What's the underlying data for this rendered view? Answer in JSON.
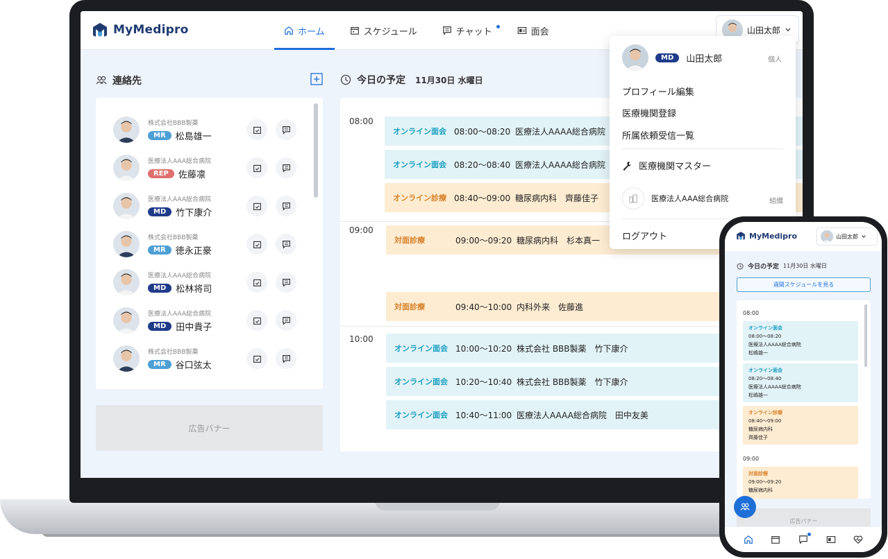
{
  "app": {
    "name": "MyMedipro"
  },
  "nav": [
    {
      "label": "ホーム",
      "icon": "home-icon",
      "active": true
    },
    {
      "label": "スケジュール",
      "icon": "calendar-icon"
    },
    {
      "label": "チャット",
      "icon": "chat-icon"
    },
    {
      "label": "面会",
      "icon": "id-card-icon"
    }
  ],
  "user": {
    "name": "山田太郎"
  },
  "contacts": {
    "title": "連絡先",
    "items": [
      {
        "org": "株式会社BBB製薬",
        "badge": "MR",
        "name": "松島雄一"
      },
      {
        "org": "医療法人AAA総合病院",
        "badge": "REP",
        "name": "佐藤凛"
      },
      {
        "org": "医療法人AAA総合病院",
        "badge": "MD",
        "name": "竹下康介"
      },
      {
        "org": "株式会社BBB製薬",
        "badge": "MR",
        "name": "徳永正豪"
      },
      {
        "org": "医療法人AAA総合病院",
        "badge": "MD",
        "name": "松林将司"
      },
      {
        "org": "医療法人AAA総合病院",
        "badge": "MD",
        "name": "田中貴子"
      },
      {
        "org": "株式会社BBB製薬",
        "badge": "MR",
        "name": "谷口弦太"
      }
    ]
  },
  "ad_banner": "広告バナー",
  "schedule": {
    "title": "今日の予定",
    "date": "11月30日 水曜日",
    "hours": [
      "08:00",
      "09:00",
      "10:00"
    ],
    "events": [
      {
        "type": "オンライン面会",
        "time": "08:00〜08:20",
        "desc": "医療法人AAAA総合病院",
        "kind": "online"
      },
      {
        "type": "オンライン面会",
        "time": "08:20〜08:40",
        "desc": "医療法人AAAA総合病院",
        "kind": "online"
      },
      {
        "type": "オンライン診療",
        "time": "08:40〜09:00",
        "desc": "糖尿病内科　齊藤佳子",
        "kind": "face"
      },
      {
        "type": "対面診療",
        "time": "09:00〜09:20",
        "desc": "糖尿病内科　杉本真一",
        "kind": "face"
      },
      {
        "type": "対面診療",
        "time": "09:40〜10:00",
        "desc": "内科外来　佐藤進",
        "kind": "face"
      },
      {
        "type": "オンライン面会",
        "time": "10:00〜10:20",
        "desc": "株式会社 BBB製薬　竹下康介",
        "kind": "online"
      },
      {
        "type": "オンライン面会",
        "time": "10:20〜10:40",
        "desc": "株式会社 BBB製薬　竹下康介",
        "kind": "online"
      },
      {
        "type": "オンライン面会",
        "time": "10:40〜11:00",
        "desc": "医療法人AAAA総合病院　田中友美",
        "kind": "online"
      }
    ]
  },
  "dropdown": {
    "badge": "MD",
    "name": "山田太郎",
    "personal_tag": "個人",
    "items": [
      "プロフィール編集",
      "医療機関登録",
      "所属依頼受信一覧"
    ],
    "master": "医療機関マスター",
    "org_name": "医療法人AAA総合病院",
    "org_tag": "組織",
    "logout": "ログアウト"
  },
  "phone": {
    "user_name": "山田太郎",
    "title": "今日の予定",
    "date": "11月30日 水曜日",
    "week_button": "週間スケジュールを見る",
    "hour1": "08:00",
    "hour2": "09:00",
    "events": [
      {
        "type": "オンライン面会",
        "l1": "08:00〜08:20",
        "l2": "医療法人AAAA総合病院",
        "l3": "松嶋雄一"
      },
      {
        "type": "オンライン面会",
        "l1": "08:20〜08:40",
        "l2": "医療法人AAAA総合病院",
        "l3": "松嶋雄一"
      },
      {
        "type": "オンライン診療",
        "l1": "08:40〜09:00",
        "l2": "糖尿病内科",
        "l3": "齊藤佳子"
      },
      {
        "type": "対面診療",
        "l1": "09:00〜09:20",
        "l2": "糖尿病内科",
        "l3": ""
      }
    ],
    "ad": "広告バナー"
  },
  "colors": {
    "accent": "#1f6fd8",
    "online": "#1a9fc0",
    "face": "#d9822b",
    "brand": "#1f3b72"
  }
}
